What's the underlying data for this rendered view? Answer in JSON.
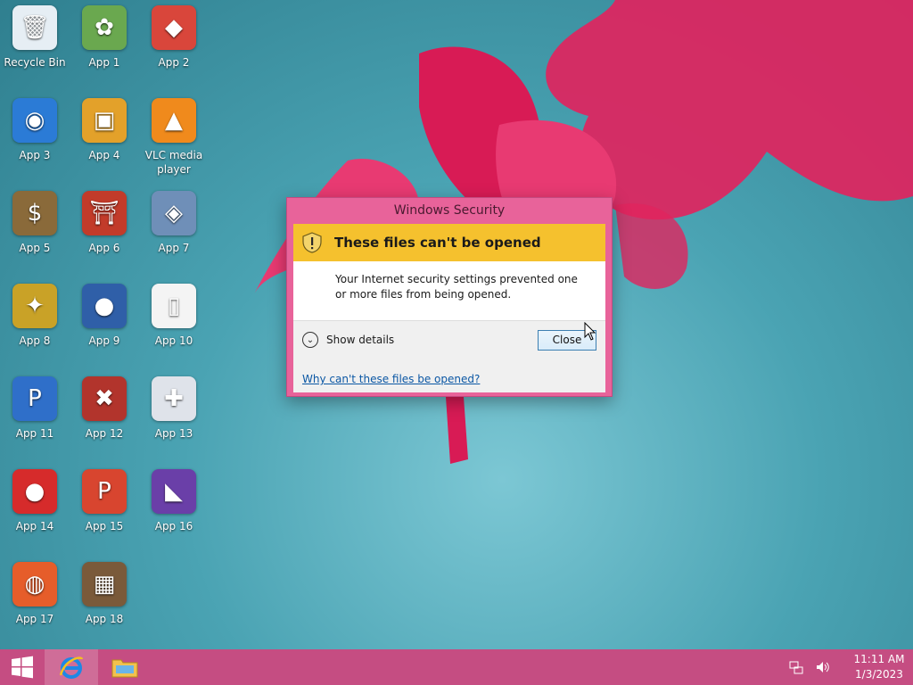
{
  "desktop": {
    "icons": [
      {
        "label": "Recycle Bin",
        "glyph": "🗑",
        "color": "#e6eef4"
      },
      {
        "label": "App 1",
        "glyph": "✿",
        "color": "#6aa84f"
      },
      {
        "label": "App 2",
        "glyph": "◆",
        "color": "#d9463b"
      },
      {
        "label": "App 3",
        "glyph": "◉",
        "color": "#2b7bd6"
      },
      {
        "label": "App 4",
        "glyph": "▣",
        "color": "#e3a12a"
      },
      {
        "label": "VLC media player",
        "glyph": "▲",
        "color": "#f08a1c"
      },
      {
        "label": "App 5",
        "glyph": "$",
        "color": "#8a6a3a"
      },
      {
        "label": "App 6",
        "glyph": "⛩",
        "color": "#c23b2a"
      },
      {
        "label": "App 7",
        "glyph": "◈",
        "color": "#6f8fb8"
      },
      {
        "label": "App 8",
        "glyph": "✦",
        "color": "#c9a227"
      },
      {
        "label": "App 9",
        "glyph": "●",
        "color": "#2f5fa8"
      },
      {
        "label": "App 10",
        "glyph": "▯",
        "color": "#f4f4f4"
      },
      {
        "label": "App 11",
        "glyph": "P",
        "color": "#2f6fc9"
      },
      {
        "label": "App 12",
        "glyph": "✖",
        "color": "#b2342c"
      },
      {
        "label": "App 13",
        "glyph": "✚",
        "color": "#dfe3ea"
      },
      {
        "label": "App 14",
        "glyph": "●",
        "color": "#d62b2b"
      },
      {
        "label": "App 15",
        "glyph": "P",
        "color": "#d8452f"
      },
      {
        "label": "App 16",
        "glyph": "◣",
        "color": "#6a3fa8"
      },
      {
        "label": "App 17",
        "glyph": "◍",
        "color": "#e65d2a"
      },
      {
        "label": "App 18",
        "glyph": "▦",
        "color": "#7a5a3a"
      }
    ]
  },
  "dialog": {
    "title": "Windows Security",
    "headline": "These files can't be opened",
    "message": "Your Internet security settings prevented one or more files from being opened.",
    "details_label": "Show details",
    "close_label": "Close",
    "help_link": "Why can't these files be opened?"
  },
  "taskbar": {
    "time": "11:11 AM",
    "date": "1/3/2023"
  },
  "colors": {
    "taskbar": "#c54d82",
    "dialog_frame": "#e8639a",
    "banner": "#f5c12e",
    "link": "#0b57a4"
  }
}
